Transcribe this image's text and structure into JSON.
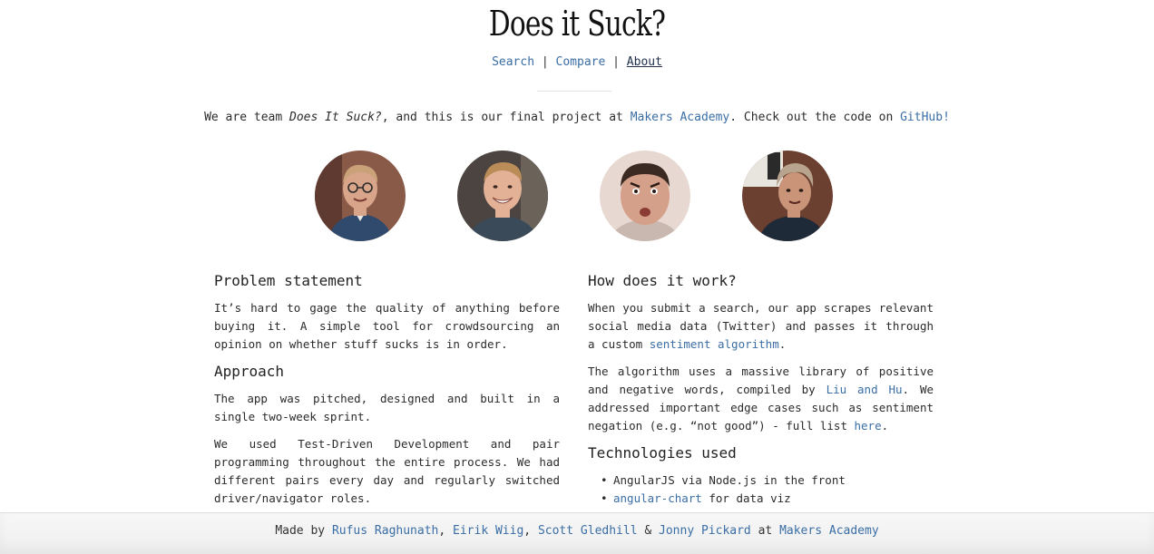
{
  "header": {
    "title": "Does it Suck?",
    "nav": {
      "search": "Search",
      "compare": "Compare",
      "about": "About",
      "separator": "|"
    }
  },
  "intro": {
    "prefix": "We are team ",
    "team_name": "Does It Suck?",
    "middle": ", and this is our final project at ",
    "makers_link": "Makers Academy",
    "middle2": ". Check out the code on ",
    "github_link": "GitHub!"
  },
  "team": [
    {
      "photo": "avatar-rufus",
      "skin": "#d8a48a",
      "hair": "#c9a27a",
      "shirt": "#2f4a6d",
      "bg": "#8a5a48"
    },
    {
      "photo": "avatar-eirik",
      "skin": "#e2b196",
      "hair": "#b98c58",
      "shirt": "#3b4a58",
      "bg": "#4b4440"
    },
    {
      "photo": "avatar-scott",
      "skin": "#d4a08a",
      "hair": "#3a2a22",
      "shirt": "#c8b8b0",
      "bg": "#e8d8d2"
    },
    {
      "photo": "avatar-jonny",
      "skin": "#c99478",
      "hair": "#b8a48e",
      "shirt": "#1f2a38",
      "bg": "#6b4030"
    }
  ],
  "left": {
    "problem_heading": "Problem statement",
    "problem_text": "It’s hard to gage the quality of anything before buying it. A simple tool for crowdsourcing an opinion on whether stuff sucks is in order.",
    "approach_heading": "Approach",
    "approach_p1": "The app was pitched, designed and built in a single two-week sprint.",
    "approach_p2": "We used Test-Driven Development and pair programming throughout the entire process. We had different pairs every day and regularly switched driver/navigator roles."
  },
  "right": {
    "how_heading": "How does it work?",
    "how_p1_a": "When you submit a search, our app scrapes relevant social media data (Twitter) and passes it through a custom ",
    "how_p1_link": "sentiment algorithm",
    "how_p1_b": ".",
    "how_p2_a": "The algorithm uses a massive library of positive and negative words, compiled by ",
    "how_p2_link": "Liu and Hu",
    "how_p2_b": ". We addressed important edge cases such as sentiment negation (e.g. “not good”) - full list ",
    "how_p2_link2": "here",
    "how_p2_c": ".",
    "tech_heading": "Technologies used",
    "tech_1": "AngularJS via Node.js in the front",
    "tech_2_link": "angular-chart",
    "tech_2_rest": " for data viz"
  },
  "footer": {
    "made_by": "Made by ",
    "member_1": "Rufus Raghunath",
    "sep_1": ", ",
    "member_2": "Eirik Wiig",
    "sep_2": ", ",
    "member_3": "Scott Gledhill",
    "amp": " & ",
    "member_4": "Jonny Pickard",
    "at": " at ",
    "academy": "Makers Academy"
  }
}
